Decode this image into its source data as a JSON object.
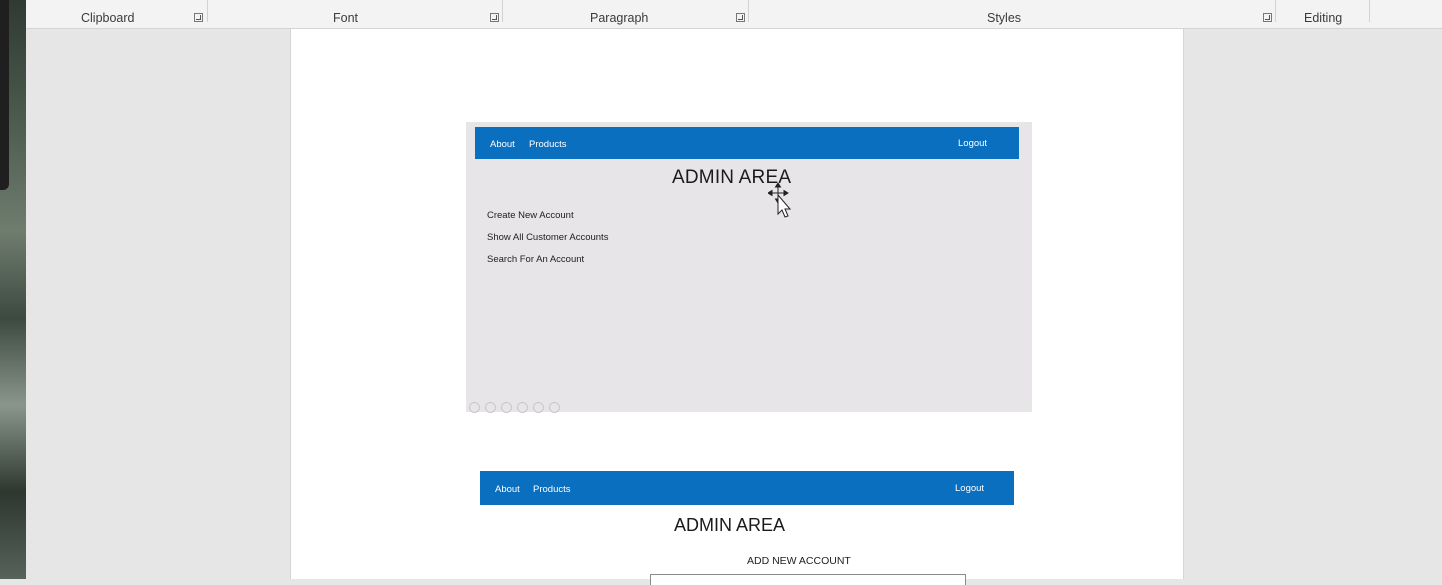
{
  "ribbon": {
    "groups": [
      "Clipboard",
      "Font",
      "Paragraph",
      "Styles",
      "Editing"
    ]
  },
  "mockup1": {
    "nav": {
      "about": "About",
      "products": "Products",
      "logout": "Logout"
    },
    "title": "ADMIN AREA",
    "menu": [
      "Create New Account",
      "Show All Customer Accounts",
      "Search For An Account"
    ]
  },
  "mockup2": {
    "nav": {
      "about": "About",
      "products": "Products",
      "logout": "Logout"
    },
    "title": "ADMIN AREA",
    "section_title": "ADD NEW ACCOUNT"
  },
  "colors": {
    "nav_blue": "#0b6fc0",
    "mock_bg": "#e8e5e8"
  }
}
